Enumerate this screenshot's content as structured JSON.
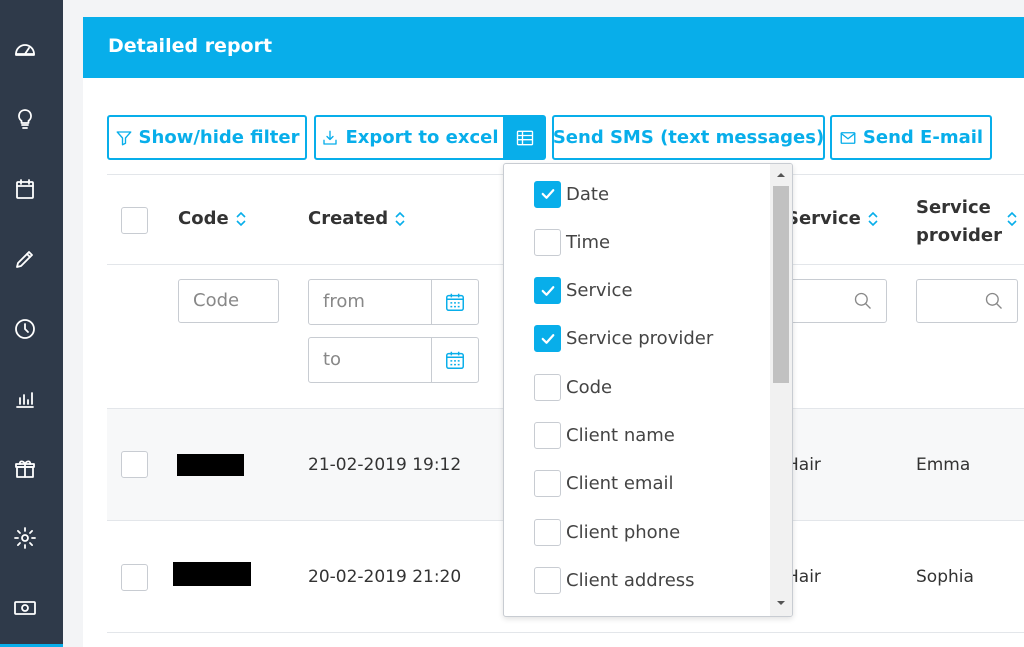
{
  "panel": {
    "title": "Detailed report"
  },
  "toolbar": {
    "filter_label": "Show/hide filter",
    "export_label": "Export to excel",
    "sms_label": "Send SMS (text messages)",
    "email_label": "Send E-mail"
  },
  "table": {
    "headers": {
      "code": "Code",
      "created": "Created",
      "service": "Service",
      "provider_line1": "Service",
      "provider_line2": "provider"
    },
    "filters": {
      "code_placeholder": "Code",
      "from_placeholder": "from",
      "to_placeholder": "to"
    },
    "rows": [
      {
        "created": "21-02-2019 19:12",
        "service": "Hair",
        "provider": "Emma"
      },
      {
        "created": "20-02-2019 21:20",
        "service": "Hair",
        "provider": "Sophia"
      }
    ]
  },
  "column_menu": {
    "items": [
      {
        "label": "Date",
        "checked": true
      },
      {
        "label": "Time",
        "checked": false
      },
      {
        "label": "Service",
        "checked": true
      },
      {
        "label": "Service provider",
        "checked": true
      },
      {
        "label": "Code",
        "checked": false
      },
      {
        "label": "Client name",
        "checked": false
      },
      {
        "label": "Client email",
        "checked": false
      },
      {
        "label": "Client phone",
        "checked": false
      },
      {
        "label": "Client address",
        "checked": false
      }
    ]
  },
  "sidebar": {
    "icons": [
      "dashboard-icon",
      "lightbulb-icon",
      "calendar-icon",
      "pencil-icon",
      "clock-icon",
      "chart-icon",
      "gift-icon",
      "gear-icon",
      "money-icon"
    ]
  },
  "colors": {
    "accent": "#08aeea",
    "sidebar": "#2f3a4a"
  }
}
